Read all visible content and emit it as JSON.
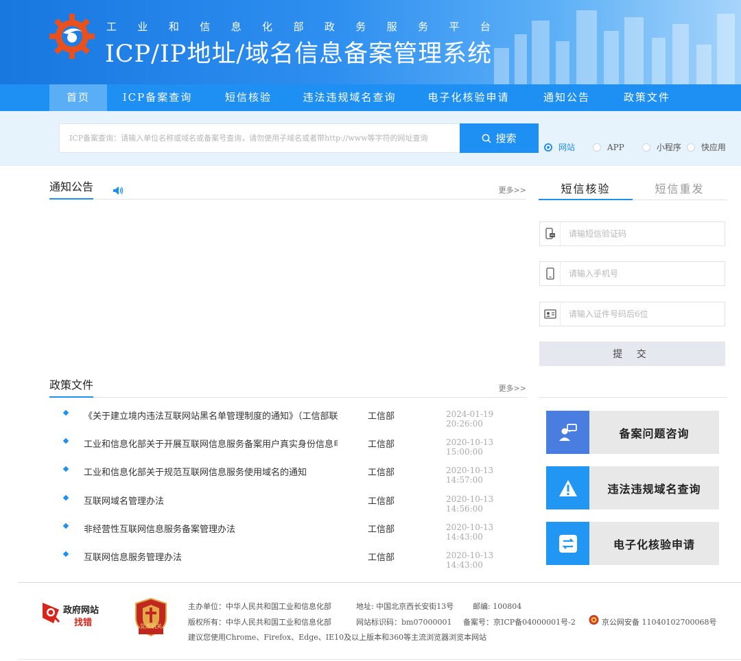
{
  "header": {
    "subtitle_chars": [
      "工",
      "业",
      "和",
      "信",
      "息",
      "化",
      "部",
      "政",
      "务",
      "服",
      "务",
      "平",
      "台"
    ],
    "title": "ICP/IP地址/域名信息备案管理系统"
  },
  "nav": [
    {
      "label": "首页",
      "active": true
    },
    {
      "label": "ICP备案查询"
    },
    {
      "label": "短信核验"
    },
    {
      "label": "违法违规域名查询"
    },
    {
      "label": "电子化核验申请"
    },
    {
      "label": "通知公告"
    },
    {
      "label": "政策文件"
    }
  ],
  "search": {
    "placeholder": "ICP备案查询：请输入单位名称或域名或备案号查询，请勿使用子域名或者带http://www等字符的网址查询",
    "button_label": "搜索",
    "options": [
      "网站",
      "APP",
      "小程序",
      "快应用"
    ],
    "selected": "网站"
  },
  "notice": {
    "title": "通知公告",
    "more": "更多>>"
  },
  "policy": {
    "title": "政策文件",
    "more": "更多>>",
    "rows": [
      {
        "title": "《关于建立境内违法互联网站黑名单管理制度的通知》（工信部联",
        "dept": "工信部",
        "date": "2024-01-19 20:26:00"
      },
      {
        "title": "工业和信息化部关于开展互联网信息服务备案用户真实身份信息电",
        "dept": "工信部",
        "date": "2020-10-13 15:00:00"
      },
      {
        "title": "工业和信息化部关于规范互联网信息服务使用域名的通知",
        "dept": "工信部",
        "date": "2020-10-13 14:57:00"
      },
      {
        "title": "互联网域名管理办法",
        "dept": "工信部",
        "date": "2020-10-13 14:56:00"
      },
      {
        "title": "非经营性互联网信息服务备案管理办法",
        "dept": "工信部",
        "date": "2020-10-13 14:43:00"
      },
      {
        "title": "互联网信息服务管理办法",
        "dept": "工信部",
        "date": "2020-10-13 14:43:00"
      }
    ]
  },
  "sms": {
    "tabs": [
      "短信核验",
      "短信重发"
    ],
    "code_placeholder": "请输短信验证码",
    "phone_placeholder": "请输入手机号",
    "id_placeholder": "请输入证件号码后6位",
    "submit": "提 交"
  },
  "quick_links": [
    {
      "label": "备案问题咨询",
      "icon": "consult-icon",
      "color": "#4a7de0"
    },
    {
      "label": "违法违规域名查询",
      "icon": "warning-icon",
      "color": "#2296f3"
    },
    {
      "label": "电子化核验申请",
      "icon": "exchange-icon",
      "color": "#2296f3"
    }
  ],
  "footer": {
    "zf_line1": "政府网站",
    "zf_line2": "找错",
    "badge_text": "党政机关",
    "host": "主办单位：中华人民共和国工业和信息化部",
    "address": "地址: 中国北京西长安街13号",
    "postcode": "邮编: 100804",
    "copyright": "版权所有：中华人民共和国工业和信息化部",
    "site_id": "网站标识码：bm07000001",
    "icp": "备案号：京ICP备04000001号-2",
    "police": "京公网安备 11040102700068号",
    "browser_tip": "建议您使用Chrome、Firefox、Edge、IE10及以上版本和360等主流浏览器浏览本网站"
  }
}
